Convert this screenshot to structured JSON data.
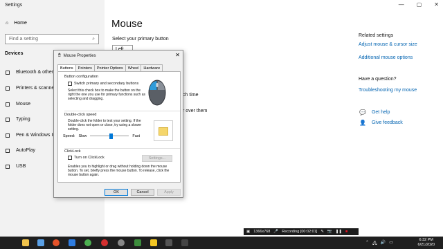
{
  "settings": {
    "window_title": "Settings",
    "controls": [
      "—",
      "▢",
      "✕"
    ],
    "home_label": "Home",
    "search_placeholder": "Find a setting",
    "section_title": "Devices",
    "sidebar_items": [
      {
        "label": "Bluetooth & other d",
        "icon": "bluetooth-icon"
      },
      {
        "label": "Printers & scanners",
        "icon": "printer-icon"
      },
      {
        "label": "Mouse",
        "icon": "mouse-icon"
      },
      {
        "label": "Typing",
        "icon": "keyboard-icon"
      },
      {
        "label": "Pen & Windows Ink",
        "icon": "pen-icon"
      },
      {
        "label": "AutoPlay",
        "icon": "autoplay-icon"
      },
      {
        "label": "USB",
        "icon": "usb-icon"
      }
    ],
    "page_title": "Mouse",
    "primary_label": "Select your primary button",
    "primary_value": "Left",
    "behind_text_1": "ch time",
    "behind_text_2": "r over them",
    "related_title": "Related settings",
    "related_links": [
      "Adjust mouse & cursor size",
      "Additional mouse options"
    ],
    "question_title": "Have a question?",
    "question_link": "Troubleshooting my mouse",
    "help_links": [
      "Get help",
      "Give feedback"
    ]
  },
  "dialog": {
    "title": "Mouse Properties",
    "tabs": [
      "Buttons",
      "Pointers",
      "Pointer Options",
      "Wheel",
      "Hardware"
    ],
    "active_tab": "Buttons",
    "button_config": {
      "group_label": "Button configuration",
      "checkbox_label": "Switch primary and secondary buttons",
      "description": "Select this check box to make the button on the right the one you use for primary functions such as selecting and dragging."
    },
    "double_click": {
      "group_label": "Double-click speed",
      "description": "Double-click the folder to test your setting. If the folder does not open or close, try using a slower setting.",
      "speed_label": "Speed:",
      "slow_label": "Slow",
      "fast_label": "Fast",
      "speed_fraction": 0.55
    },
    "clicklock": {
      "group_label": "ClickLock",
      "checkbox_label": "Turn on ClickLock",
      "settings_button": "Settings...",
      "description": "Enables you to highlight or drag without holding down the mouse button. To set, briefly press the mouse button. To release, click the mouse button again."
    },
    "buttons": {
      "ok": "OK",
      "cancel": "Cancel",
      "apply": "Apply"
    }
  },
  "recording": {
    "resolution": "1366x768",
    "status": "Recording [00:02:01]"
  },
  "taskbar": {
    "time": "6:32 PM",
    "date": "6/21/2020"
  }
}
